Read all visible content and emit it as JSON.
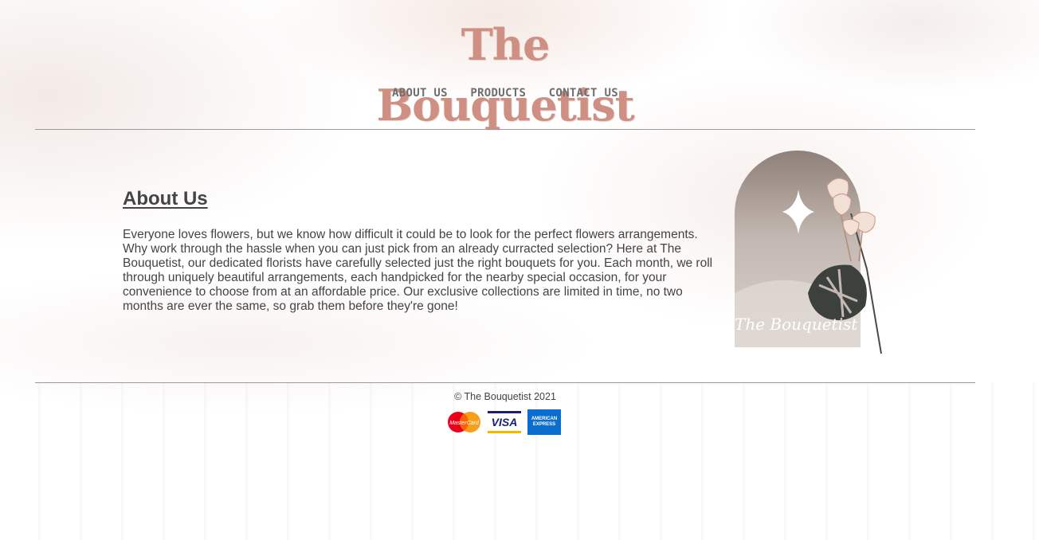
{
  "brand": {
    "logo_text": "The Bouquetist"
  },
  "nav": {
    "items": [
      "ABOUT US",
      "PRODUCTS",
      "CONTACT US"
    ]
  },
  "about": {
    "heading": "About Us",
    "body": "Everyone loves flowers, but we know how difficult it could be to look for the perfect flowers arrangements. Why work through the hassle when you can just pick from an already curracted selection? Here at The Bouquetist, our dedicated florists have carefully selected just the right bouquets for you. Each month, we roll through uniquely beautiful arrangements, each handpicked for the nearby special occasion, for your convenience to choose from at an affordable price. Our exclusive collections are limited in time, no two months are ever the same, so grab them before they're gone!",
    "image_signature": "The Bouquetist"
  },
  "footer": {
    "copyright": "© The Bouquetist 2021",
    "payment_cards": [
      {
        "name": "mastercard",
        "label": "MasterCard"
      },
      {
        "name": "visa",
        "label": "VISA"
      },
      {
        "name": "amex",
        "label": "AMERICAN EXPRESS"
      }
    ]
  },
  "colors": {
    "logo": "#cf8f82",
    "text": "#444444",
    "nav": "#6e6e6e",
    "rule": "#9a9a9a"
  }
}
